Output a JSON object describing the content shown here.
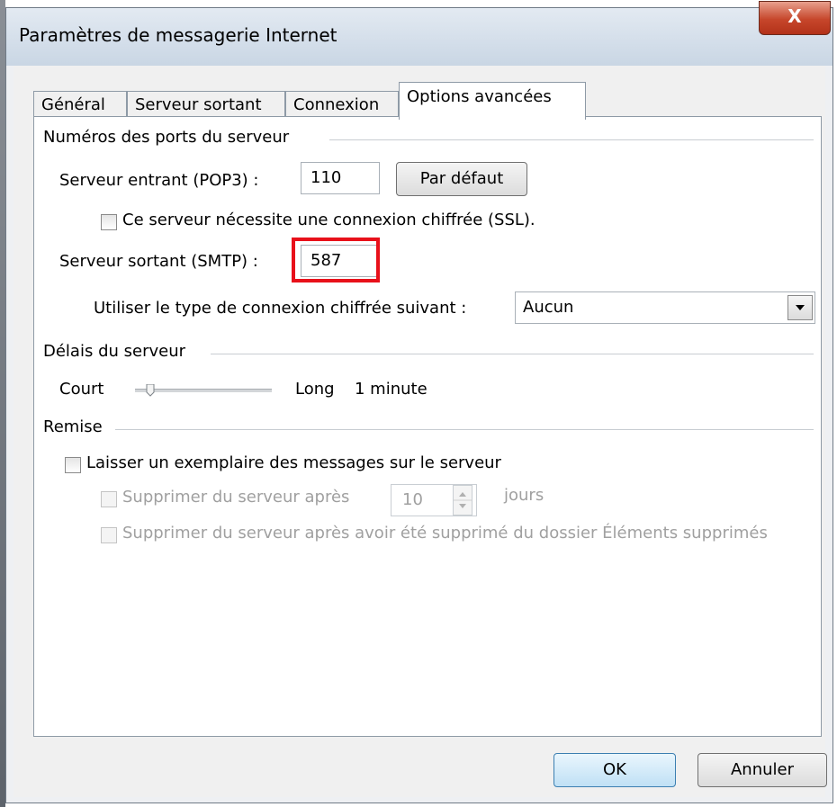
{
  "window": {
    "title": "Paramètres de messagerie Internet",
    "close_glyph": "X"
  },
  "tabs": [
    {
      "label": "Général",
      "active": false
    },
    {
      "label": "Serveur sortant",
      "active": false
    },
    {
      "label": "Connexion",
      "active": false
    },
    {
      "label": "Options avancées",
      "active": true
    }
  ],
  "ports": {
    "section_title": "Numéros des ports du serveur",
    "incoming_label": "Serveur entrant (POP3) :",
    "incoming_value": "110",
    "default_button": "Par défaut",
    "ssl_label": "Ce serveur nécessite une connexion chiffrée (SSL).",
    "ssl_checked": false,
    "outgoing_label": "Serveur sortant (SMTP) :",
    "outgoing_value": "587",
    "encryption_label": "Utiliser le type de connexion chiffrée suivant :",
    "encryption_value": "Aucun"
  },
  "timeouts": {
    "section_title": "Délais du serveur",
    "short_label": "Court",
    "long_label": "Long",
    "value_label": "1 minute",
    "slider_level": 0.1
  },
  "delivery": {
    "section_title": "Remise",
    "leave_copy_label": "Laisser un exemplaire des messages sur le serveur",
    "remove_after_label": "Supprimer du serveur après",
    "days_value": "10",
    "days_unit": "jours",
    "remove_deleted_label": "Supprimer du serveur après avoir été supprimé du dossier Éléments supprimés"
  },
  "buttons": {
    "ok": "OK",
    "cancel": "Annuler"
  },
  "colors": {
    "highlight": "#e8101a",
    "close_button": "#c6462b"
  }
}
